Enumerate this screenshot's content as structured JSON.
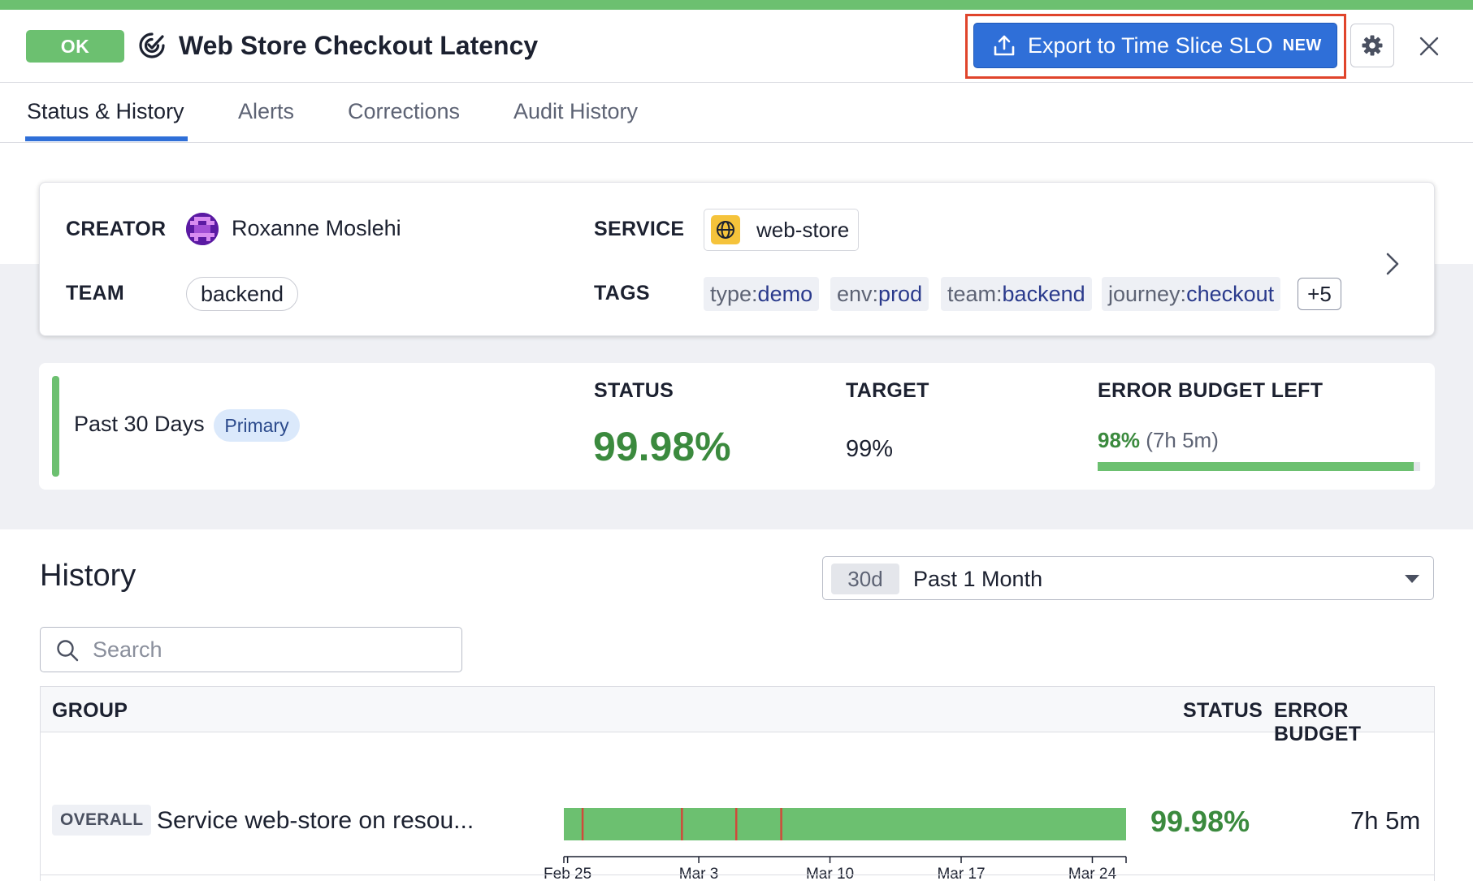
{
  "header": {
    "status_badge": "OK",
    "title": "Web Store Checkout Latency",
    "export_button": {
      "label": "Export to Time Slice SLO",
      "tag": "NEW"
    }
  },
  "tabs": [
    {
      "label": "Status & History",
      "active": true
    },
    {
      "label": "Alerts",
      "active": false
    },
    {
      "label": "Corrections",
      "active": false
    },
    {
      "label": "Audit History",
      "active": false
    }
  ],
  "meta": {
    "creator_label": "CREATOR",
    "creator_name": "Roxanne Moslehi",
    "team_label": "TEAM",
    "team_value": "backend",
    "service_label": "SERVICE",
    "service_value": "web-store",
    "tags_label": "TAGS",
    "tags": [
      {
        "key": "type:",
        "value": "demo"
      },
      {
        "key": "env:",
        "value": "prod"
      },
      {
        "key": "team:",
        "value": "backend"
      },
      {
        "key": "journey:",
        "value": "checkout"
      }
    ],
    "more_tags": "+5"
  },
  "summary": {
    "window": "Past 30 Days",
    "badge": "Primary",
    "status_label": "STATUS",
    "status_value": "99.98%",
    "target_label": "TARGET",
    "target_value": "99%",
    "budget_label": "ERROR BUDGET LEFT",
    "budget_pct": "98%",
    "budget_time": "(7h 5m)",
    "budget_fraction": 0.98
  },
  "history": {
    "title": "History",
    "range_chip": "30d",
    "range_label": "Past 1 Month",
    "search_placeholder": "Search",
    "columns": {
      "group": "GROUP",
      "status": "STATUS",
      "error_budget": "ERROR BUDGET"
    },
    "rows": [
      {
        "badge": "OVERALL",
        "name": "Service web-store on resou...",
        "status": "99.98%",
        "error_budget": "7h 5m"
      }
    ],
    "timeline": {
      "ticks": [
        "Feb 25",
        "Mar 3",
        "Mar 10",
        "Mar 17",
        "Mar 24"
      ],
      "range_days": [
        0,
        30
      ],
      "tick_days": [
        0.2,
        7.2,
        14.2,
        21.2,
        28.2
      ],
      "breach_days": [
        1.0,
        6.3,
        9.2,
        11.6
      ]
    }
  },
  "colors": {
    "ok_green": "#6cc070",
    "value_green": "#3b8a3e",
    "primary_blue": "#2f6fd8",
    "breach_red": "#d04a3a",
    "highlight_red": "#e0442b"
  }
}
